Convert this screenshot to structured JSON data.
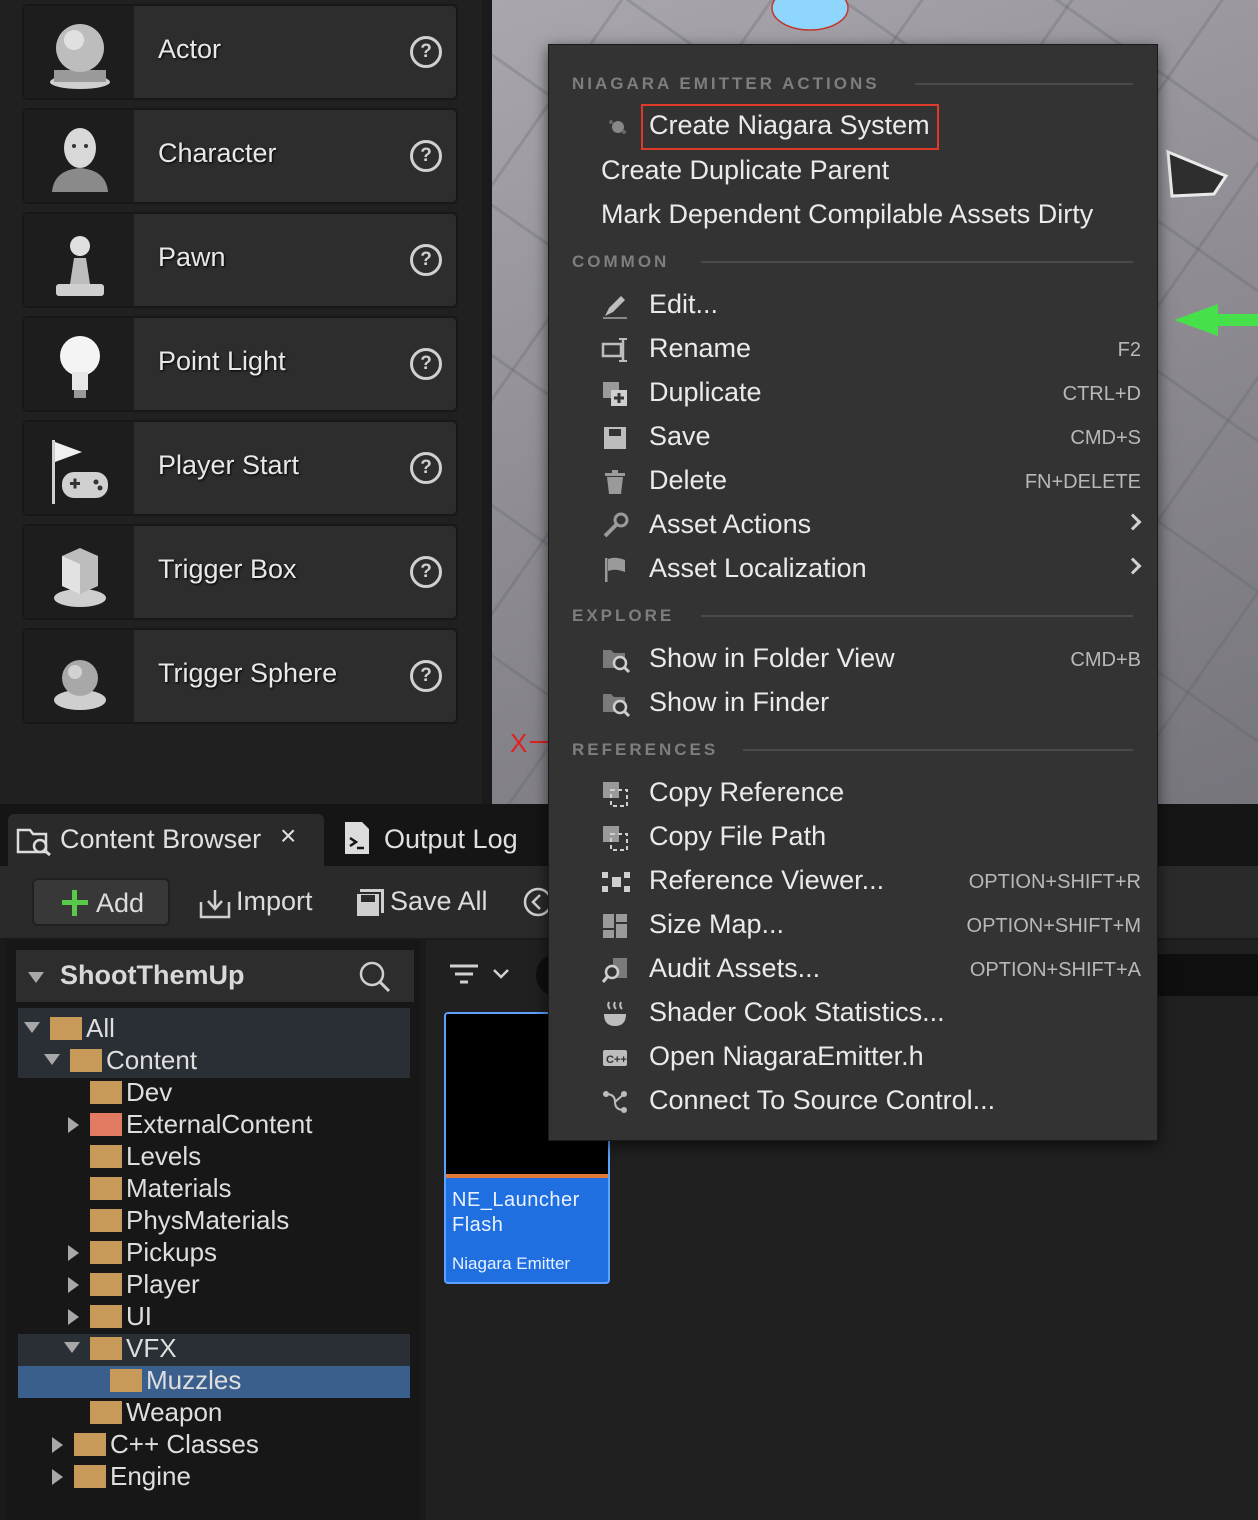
{
  "place_actors": {
    "items": [
      {
        "label": "Actor",
        "icon": "sphere-on-base-icon"
      },
      {
        "label": "Character",
        "icon": "character-bust-icon"
      },
      {
        "label": "Pawn",
        "icon": "pawn-icon"
      },
      {
        "label": "Point Light",
        "icon": "light-bulb-icon"
      },
      {
        "label": "Player Start",
        "icon": "flag-gamepad-icon"
      },
      {
        "label": "Trigger Box",
        "icon": "cube-on-base-icon"
      },
      {
        "label": "Trigger Sphere",
        "icon": "sphere-on-base-icon"
      }
    ],
    "help_label": "?"
  },
  "context_menu": {
    "sections": [
      {
        "header": "NIAGARA EMITTER ACTIONS"
      },
      {
        "header": "COMMON"
      },
      {
        "header": "EXPLORE"
      },
      {
        "header": "REFERENCES"
      }
    ],
    "items": [
      {
        "label": "Create Niagara System",
        "shortcut": "",
        "icon": "niagara-icon",
        "highlighted": true
      },
      {
        "label": "Create Duplicate Parent",
        "shortcut": ""
      },
      {
        "label": "Mark Dependent Compilable Assets Dirty",
        "shortcut": ""
      },
      {
        "label": "Edit...",
        "shortcut": "",
        "icon": "pencil-icon"
      },
      {
        "label": "Rename",
        "shortcut": "F2",
        "icon": "rename-icon"
      },
      {
        "label": "Duplicate",
        "shortcut": "CTRL+D",
        "icon": "duplicate-icon"
      },
      {
        "label": "Save",
        "shortcut": "CMD+S",
        "icon": "save-icon"
      },
      {
        "label": "Delete",
        "shortcut": "FN+DELETE",
        "icon": "trash-icon"
      },
      {
        "label": "Asset Actions",
        "shortcut": "",
        "icon": "wrench-icon",
        "submenu": true
      },
      {
        "label": "Asset Localization",
        "shortcut": "",
        "icon": "flag-icon",
        "submenu": true
      },
      {
        "label": "Show in Folder View",
        "shortcut": "CMD+B",
        "icon": "folder-search-icon"
      },
      {
        "label": "Show in Finder",
        "shortcut": "",
        "icon": "folder-search-icon"
      },
      {
        "label": "Copy Reference",
        "shortcut": "",
        "icon": "copy-icon"
      },
      {
        "label": "Copy File Path",
        "shortcut": "",
        "icon": "copy-icon"
      },
      {
        "label": "Reference Viewer...",
        "shortcut": "OPTION+SHIFT+R",
        "icon": "reference-viewer-icon"
      },
      {
        "label": "Size Map...",
        "shortcut": "OPTION+SHIFT+M",
        "icon": "size-map-icon"
      },
      {
        "label": "Audit Assets...",
        "shortcut": "OPTION+SHIFT+A",
        "icon": "audit-icon"
      },
      {
        "label": "Shader Cook Statistics...",
        "shortcut": "",
        "icon": "shader-icon"
      },
      {
        "label": "Open NiagaraEmitter.h",
        "shortcut": "",
        "icon": "cpp-icon"
      },
      {
        "label": "Connect To Source Control...",
        "shortcut": "",
        "icon": "source-control-icon"
      }
    ],
    "highlight_color": "#e03a2a"
  },
  "tabs": {
    "content_browser": "Content Browser",
    "close": "×",
    "output_log": "Output Log"
  },
  "toolbar": {
    "add": "Add",
    "import": "Import",
    "save_all": "Save All"
  },
  "tree": {
    "root": "ShootThemUp",
    "rows": [
      {
        "name": "All",
        "color": "#c89a5a"
      },
      {
        "name": "Content",
        "color": "#c89a5a"
      },
      {
        "name": "Dev",
        "color": "#c89a5a"
      },
      {
        "name": "ExternalContent",
        "color": "#e07a60"
      },
      {
        "name": "Levels",
        "color": "#c89a5a"
      },
      {
        "name": "Materials",
        "color": "#c89a5a"
      },
      {
        "name": "PhysMaterials",
        "color": "#c89a5a"
      },
      {
        "name": "Pickups",
        "color": "#c89a5a"
      },
      {
        "name": "Player",
        "color": "#c89a5a"
      },
      {
        "name": "UI",
        "color": "#c89a5a"
      },
      {
        "name": "VFX",
        "color": "#c89a5a"
      },
      {
        "name": "Muzzles",
        "color": "#c89a5a"
      },
      {
        "name": "Weapon",
        "color": "#c89a5a"
      },
      {
        "name": "C++ Classes",
        "color": "#c89a5a"
      },
      {
        "name": "Engine",
        "color": "#c89a5a"
      }
    ]
  },
  "asset": {
    "name": "NE_Launcher Flash",
    "type": "Niagara Emitter"
  }
}
